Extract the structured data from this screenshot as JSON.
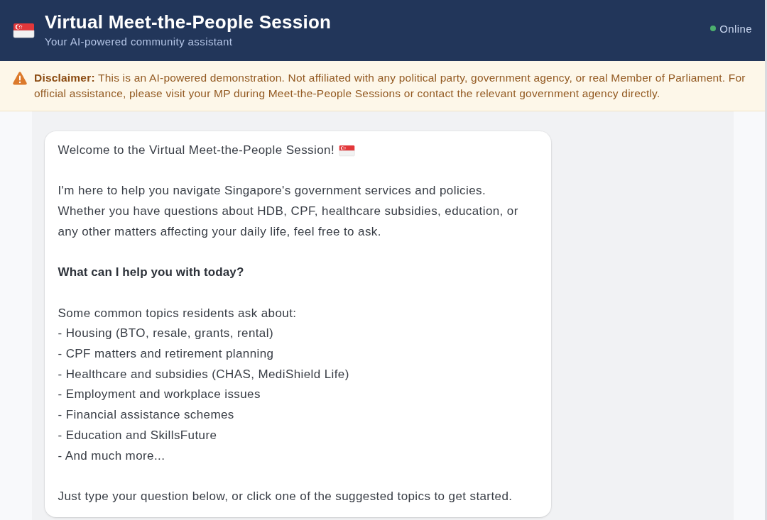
{
  "header": {
    "title": "Virtual Meet-the-People Session",
    "subtitle": "Your AI-powered community assistant",
    "status": {
      "label": "Online",
      "online": true
    }
  },
  "disclaimer": {
    "text": "**Disclaimer:** This is an AI-powered demonstration. Not affiliated with any political party, government agency, or real Member of Parliament. For official assistance, please visit your MP during Meet-the-People Sessions or contact the relevant government agency directly."
  },
  "messages": [
    {
      "blocks": [
        {
          "kind": "text",
          "text": "Welcome to the Virtual Meet-the-People Session!",
          "flag": true
        },
        {
          "kind": "text",
          "text": "I'm here to help you navigate Singapore's government services and policies. Whether you have questions about HDB, CPF, healthcare subsidies, education, or any other matters affecting your daily life, feel free to ask."
        },
        {
          "kind": "heading",
          "text": "What can I help you with today?"
        },
        {
          "kind": "list",
          "intro": "Some common topics residents ask about:",
          "items": [
            "- Housing (BTO, resale, grants, rental)",
            "- CPF matters and retirement planning",
            "- Healthcare and subsidies (CHAS, MediShield Life)",
            "- Employment and workplace issues",
            "- Financial assistance schemes",
            "- Education and SkillsFuture",
            "- And much more..."
          ]
        },
        {
          "kind": "text",
          "text": "Just type your question below, or click one of the suggested topics to get started."
        }
      ]
    }
  ]
}
